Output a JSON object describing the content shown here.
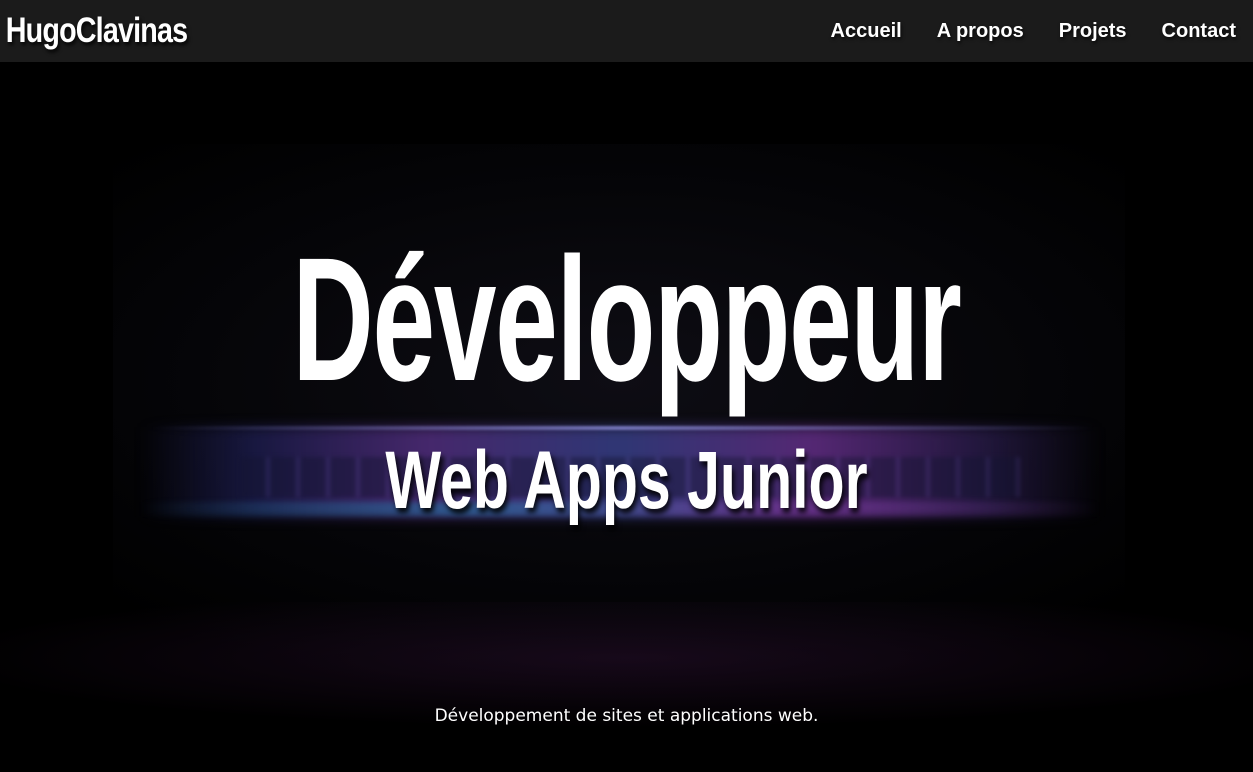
{
  "navbar": {
    "brand": "HugoClavinas",
    "links": [
      {
        "label": "Accueil"
      },
      {
        "label": "A propos"
      },
      {
        "label": "Projets"
      },
      {
        "label": "Contact"
      }
    ]
  },
  "hero": {
    "title": "Développeur",
    "subtitle": "Web Apps Junior",
    "tagline": "Développement de sites et applications web.",
    "background_image": "laptop-dark-keyboard-glow"
  },
  "colors": {
    "navbar_bg": "#1b1b1b",
    "page_bg": "#000000",
    "text": "#ffffff",
    "glow_purple": "#5a3290",
    "glow_blue": "#286ea0"
  }
}
